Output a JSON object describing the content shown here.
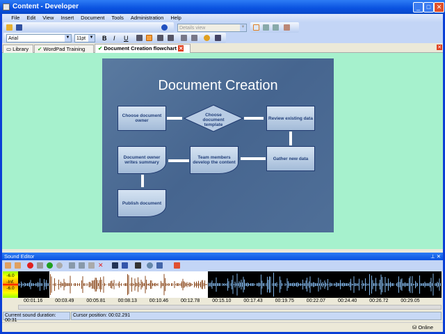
{
  "window": {
    "title": "Content - Developer"
  },
  "menu": [
    "File",
    "Edit",
    "View",
    "Insert",
    "Document",
    "Tools",
    "Administration",
    "Help"
  ],
  "toolbar": {
    "view_combo": "Details view",
    "font": "Arial",
    "size": "11pt"
  },
  "tabs": [
    {
      "label": "Library"
    },
    {
      "label": "WordPad Training"
    },
    {
      "label": "Document Creation flowchart"
    }
  ],
  "slide": {
    "title": "Document Creation",
    "nodes": [
      "Choose document owner",
      "Choose document template",
      "Review existing data",
      "Gather new data",
      "Team members develop the content",
      "Document owner writes summary",
      "Publish document"
    ]
  },
  "sound_editor": {
    "title": "Sound Editor",
    "meter": [
      "-6.0",
      "-Inf.",
      "-6.0"
    ],
    "ticks": [
      "00:01.16",
      "00:03.49",
      "00:05.81",
      "00:08.13",
      "00:10.46",
      "00:12.78",
      "00:15.10",
      "00:17.43",
      "00:19.75",
      "00:22.07",
      "00:24.40",
      "00:26.72",
      "00:29.05"
    ],
    "duration": "Current sound duration: 00:31",
    "cursor": "Cursor position: 00:02.291"
  },
  "status": {
    "online": "Online"
  },
  "colors": {
    "accent": "#0a52e0",
    "background": "#a6f1cd",
    "wave_selected": "#8b4a1e",
    "wave": "#7fb3e6"
  }
}
